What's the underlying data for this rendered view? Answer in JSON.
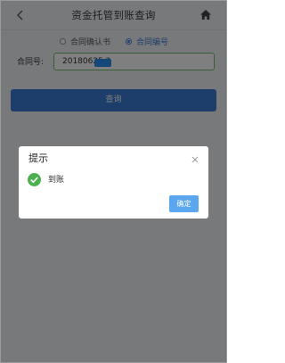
{
  "header": {
    "title": "资金托管到账查询",
    "back_icon": "chevron-left-icon",
    "home_icon": "home-icon"
  },
  "search_type": {
    "options": [
      {
        "label": "合同确认书",
        "selected": false
      },
      {
        "label": "合同编号",
        "selected": true
      }
    ]
  },
  "contract": {
    "label": "合同号:",
    "value": "20180625  2"
  },
  "query_button": {
    "label": "查询"
  },
  "dialog": {
    "title": "提示",
    "message": "到账",
    "ok_label": "确定",
    "close_icon": "close-icon",
    "status_icon": "check-circle-icon"
  },
  "colors": {
    "primary": "#3b7bd6",
    "success": "#4caf50",
    "input_border": "#6fbf6a",
    "ok_button": "#5aa6ef"
  }
}
